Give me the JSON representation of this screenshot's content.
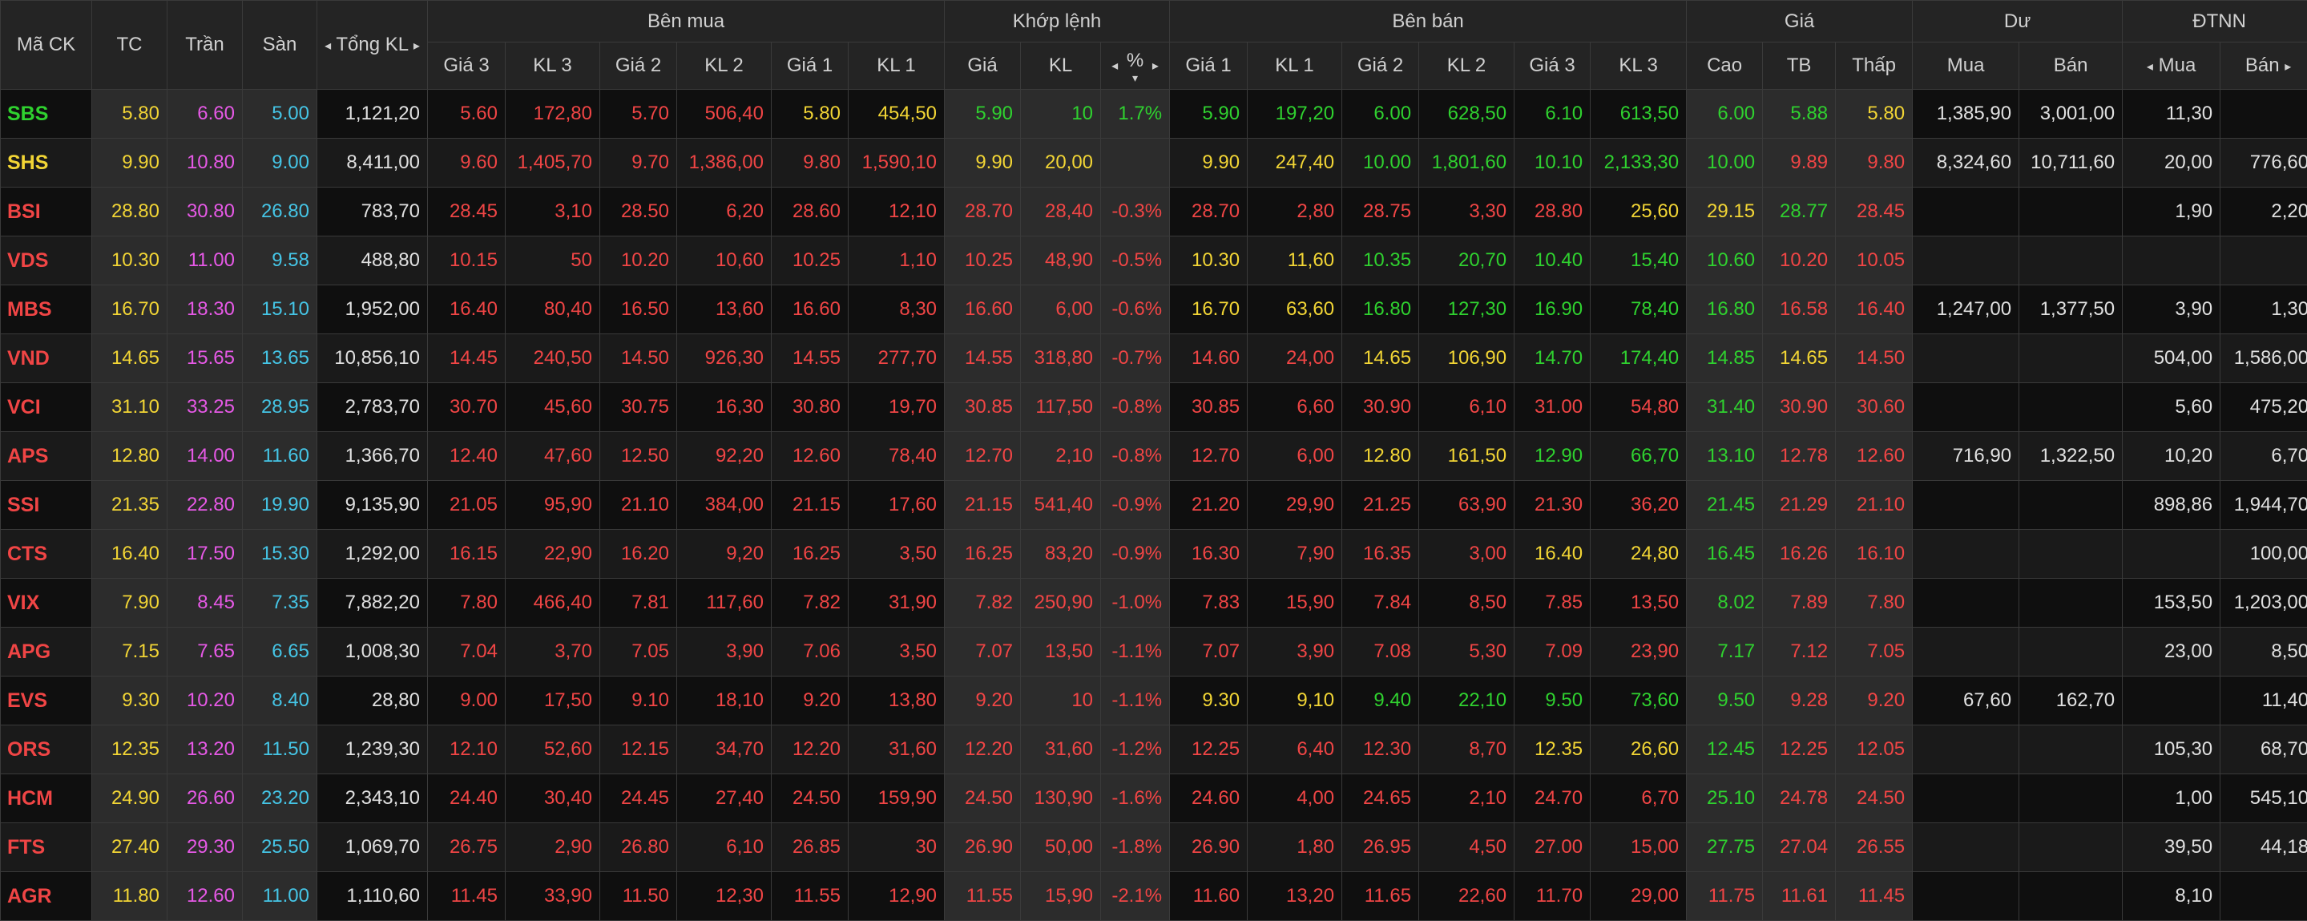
{
  "colors": {
    "up": "#2fd12f",
    "ref": "#f2d535",
    "down": "#f04545",
    "ceil": "#e659e6",
    "floor": "#45c5e6",
    "neutral": "#e0e0e0"
  },
  "headers": {
    "symbol": "Mã CK",
    "ref": "TC",
    "ceil": "Trần",
    "floor": "Sàn",
    "total_vol": "Tổng KL",
    "buy_side": "Bên mua",
    "match": "Khớp lệnh",
    "sell_side": "Bên bán",
    "price": "Giá",
    "remain": "Dư",
    "foreign": "ĐTNN",
    "buy": [
      "Giá 3",
      "KL 3",
      "Giá 2",
      "KL 2",
      "Giá 1",
      "KL 1"
    ],
    "match_cols": [
      "Giá",
      "KL",
      "%"
    ],
    "sell": [
      "Giá 1",
      "KL 1",
      "Giá 2",
      "KL 2",
      "Giá 3",
      "KL 3"
    ],
    "price_cols": [
      "Cao",
      "TB",
      "Thấp"
    ],
    "remain_cols": [
      "Mua",
      "Bán"
    ],
    "foreign_cols": [
      "Mua",
      "Bán"
    ]
  },
  "icons": {
    "left": "◂",
    "right": "▸",
    "sort_down": "▾"
  },
  "rows": [
    {
      "symbol": "SBS",
      "cells": [
        "5.80",
        "6.60",
        "5.00",
        "1,121,20",
        "5.60",
        "172,80",
        "5.70",
        "506,40",
        "5.80",
        "454,50",
        "5.90",
        "10",
        "1.7%",
        "5.90",
        "197,20",
        "6.00",
        "628,50",
        "6.10",
        "613,50",
        "6.00",
        "5.88",
        "5.80",
        "1,385,90",
        "3,001,00",
        "11,30",
        ""
      ],
      "colors": [
        "up",
        "ref",
        "ceil",
        "floor",
        "neutral",
        "down",
        "down",
        "down",
        "down",
        "ref",
        "ref",
        "up",
        "up",
        "up",
        "up",
        "up",
        "up",
        "up",
        "up",
        "up",
        "up",
        "up",
        "ref",
        "neutral",
        "neutral",
        "neutral",
        "neutral"
      ]
    },
    {
      "symbol": "SHS",
      "cells": [
        "9.90",
        "10.80",
        "9.00",
        "8,411,00",
        "9.60",
        "1,405,70",
        "9.70",
        "1,386,00",
        "9.80",
        "1,590,10",
        "9.90",
        "20,00",
        "",
        "9.90",
        "247,40",
        "10.00",
        "1,801,60",
        "10.10",
        "2,133,30",
        "10.00",
        "9.89",
        "9.80",
        "8,324,60",
        "10,711,60",
        "20,00",
        "776,60"
      ],
      "colors": [
        "ref",
        "ref",
        "ceil",
        "floor",
        "neutral",
        "down",
        "down",
        "down",
        "down",
        "down",
        "down",
        "ref",
        "ref",
        "ref",
        "ref",
        "ref",
        "up",
        "up",
        "up",
        "up",
        "up",
        "down",
        "down",
        "neutral",
        "neutral",
        "neutral",
        "neutral"
      ]
    },
    {
      "symbol": "BSI",
      "cells": [
        "28.80",
        "30.80",
        "26.80",
        "783,70",
        "28.45",
        "3,10",
        "28.50",
        "6,20",
        "28.60",
        "12,10",
        "28.70",
        "28,40",
        "-0.3%",
        "28.70",
        "2,80",
        "28.75",
        "3,30",
        "28.80",
        "25,60",
        "29.15",
        "28.77",
        "28.45",
        "",
        "",
        "1,90",
        "2,20"
      ],
      "colors": [
        "down",
        "ref",
        "ceil",
        "floor",
        "neutral",
        "down",
        "down",
        "down",
        "down",
        "down",
        "down",
        "down",
        "down",
        "down",
        "down",
        "down",
        "down",
        "down",
        "down",
        "ref",
        "ref",
        "up",
        "down",
        "down",
        "neutral",
        "neutral",
        "neutral",
        "neutral"
      ]
    },
    {
      "symbol": "VDS",
      "cells": [
        "10.30",
        "11.00",
        "9.58",
        "488,80",
        "10.15",
        "50",
        "10.20",
        "10,60",
        "10.25",
        "1,10",
        "10.25",
        "48,90",
        "-0.5%",
        "10.30",
        "11,60",
        "10.35",
        "20,70",
        "10.40",
        "15,40",
        "10.60",
        "10.20",
        "10.05",
        "",
        "",
        "",
        ""
      ],
      "colors": [
        "down",
        "ref",
        "ceil",
        "floor",
        "neutral",
        "down",
        "down",
        "down",
        "down",
        "down",
        "down",
        "down",
        "down",
        "down",
        "ref",
        "ref",
        "up",
        "up",
        "up",
        "up",
        "up",
        "down",
        "down",
        "neutral",
        "neutral",
        "neutral",
        "neutral"
      ]
    },
    {
      "symbol": "MBS",
      "cells": [
        "16.70",
        "18.30",
        "15.10",
        "1,952,00",
        "16.40",
        "80,40",
        "16.50",
        "13,60",
        "16.60",
        "8,30",
        "16.60",
        "6,00",
        "-0.6%",
        "16.70",
        "63,60",
        "16.80",
        "127,30",
        "16.90",
        "78,40",
        "16.80",
        "16.58",
        "16.40",
        "1,247,00",
        "1,377,50",
        "3,90",
        "1,30"
      ],
      "colors": [
        "down",
        "ref",
        "ceil",
        "floor",
        "neutral",
        "down",
        "down",
        "down",
        "down",
        "down",
        "down",
        "down",
        "down",
        "down",
        "ref",
        "ref",
        "up",
        "up",
        "up",
        "up",
        "up",
        "down",
        "down",
        "neutral",
        "neutral",
        "neutral",
        "neutral"
      ]
    },
    {
      "symbol": "VND",
      "cells": [
        "14.65",
        "15.65",
        "13.65",
        "10,856,10",
        "14.45",
        "240,50",
        "14.50",
        "926,30",
        "14.55",
        "277,70",
        "14.55",
        "318,80",
        "-0.7%",
        "14.60",
        "24,00",
        "14.65",
        "106,90",
        "14.70",
        "174,40",
        "14.85",
        "14.65",
        "14.50",
        "",
        "",
        "504,00",
        "1,586,00"
      ],
      "colors": [
        "down",
        "ref",
        "ceil",
        "floor",
        "neutral",
        "down",
        "down",
        "down",
        "down",
        "down",
        "down",
        "down",
        "down",
        "down",
        "down",
        "down",
        "ref",
        "ref",
        "up",
        "up",
        "up",
        "ref",
        "down",
        "neutral",
        "neutral",
        "neutral",
        "neutral"
      ]
    },
    {
      "symbol": "VCI",
      "cells": [
        "31.10",
        "33.25",
        "28.95",
        "2,783,70",
        "30.70",
        "45,60",
        "30.75",
        "16,30",
        "30.80",
        "19,70",
        "30.85",
        "117,50",
        "-0.8%",
        "30.85",
        "6,60",
        "30.90",
        "6,10",
        "31.00",
        "54,80",
        "31.40",
        "30.90",
        "30.60",
        "",
        "",
        "5,60",
        "475,20"
      ],
      "colors": [
        "down",
        "ref",
        "ceil",
        "floor",
        "neutral",
        "down",
        "down",
        "down",
        "down",
        "down",
        "down",
        "down",
        "down",
        "down",
        "down",
        "down",
        "down",
        "down",
        "down",
        "down",
        "up",
        "down",
        "down",
        "neutral",
        "neutral",
        "neutral",
        "neutral"
      ]
    },
    {
      "symbol": "APS",
      "cells": [
        "12.80",
        "14.00",
        "11.60",
        "1,366,70",
        "12.40",
        "47,60",
        "12.50",
        "92,20",
        "12.60",
        "78,40",
        "12.70",
        "2,10",
        "-0.8%",
        "12.70",
        "6,00",
        "12.80",
        "161,50",
        "12.90",
        "66,70",
        "13.10",
        "12.78",
        "12.60",
        "716,90",
        "1,322,50",
        "10,20",
        "6,70"
      ],
      "colors": [
        "down",
        "ref",
        "ceil",
        "floor",
        "neutral",
        "down",
        "down",
        "down",
        "down",
        "down",
        "down",
        "down",
        "down",
        "down",
        "down",
        "down",
        "ref",
        "ref",
        "up",
        "up",
        "up",
        "down",
        "down",
        "neutral",
        "neutral",
        "neutral",
        "neutral"
      ]
    },
    {
      "symbol": "SSI",
      "cells": [
        "21.35",
        "22.80",
        "19.90",
        "9,135,90",
        "21.05",
        "95,90",
        "21.10",
        "384,00",
        "21.15",
        "17,60",
        "21.15",
        "541,40",
        "-0.9%",
        "21.20",
        "29,90",
        "21.25",
        "63,90",
        "21.30",
        "36,20",
        "21.45",
        "21.29",
        "21.10",
        "",
        "",
        "898,86",
        "1,944,70"
      ],
      "colors": [
        "down",
        "ref",
        "ceil",
        "floor",
        "neutral",
        "down",
        "down",
        "down",
        "down",
        "down",
        "down",
        "down",
        "down",
        "down",
        "down",
        "down",
        "down",
        "down",
        "down",
        "down",
        "up",
        "down",
        "down",
        "neutral",
        "neutral",
        "neutral",
        "neutral"
      ]
    },
    {
      "symbol": "CTS",
      "cells": [
        "16.40",
        "17.50",
        "15.30",
        "1,292,00",
        "16.15",
        "22,90",
        "16.20",
        "9,20",
        "16.25",
        "3,50",
        "16.25",
        "83,20",
        "-0.9%",
        "16.30",
        "7,90",
        "16.35",
        "3,00",
        "16.40",
        "24,80",
        "16.45",
        "16.26",
        "16.10",
        "",
        "",
        "",
        "100,00"
      ],
      "colors": [
        "down",
        "ref",
        "ceil",
        "floor",
        "neutral",
        "down",
        "down",
        "down",
        "down",
        "down",
        "down",
        "down",
        "down",
        "down",
        "down",
        "down",
        "down",
        "down",
        "ref",
        "ref",
        "up",
        "down",
        "down",
        "neutral",
        "neutral",
        "neutral",
        "neutral"
      ]
    },
    {
      "symbol": "VIX",
      "cells": [
        "7.90",
        "8.45",
        "7.35",
        "7,882,20",
        "7.80",
        "466,40",
        "7.81",
        "117,60",
        "7.82",
        "31,90",
        "7.82",
        "250,90",
        "-1.0%",
        "7.83",
        "15,90",
        "7.84",
        "8,50",
        "7.85",
        "13,50",
        "8.02",
        "7.89",
        "7.80",
        "",
        "",
        "153,50",
        "1,203,00"
      ],
      "colors": [
        "down",
        "ref",
        "ceil",
        "floor",
        "neutral",
        "down",
        "down",
        "down",
        "down",
        "down",
        "down",
        "down",
        "down",
        "down",
        "down",
        "down",
        "down",
        "down",
        "down",
        "down",
        "up",
        "down",
        "down",
        "neutral",
        "neutral",
        "neutral",
        "neutral"
      ]
    },
    {
      "symbol": "APG",
      "cells": [
        "7.15",
        "7.65",
        "6.65",
        "1,008,30",
        "7.04",
        "3,70",
        "7.05",
        "3,90",
        "7.06",
        "3,50",
        "7.07",
        "13,50",
        "-1.1%",
        "7.07",
        "3,90",
        "7.08",
        "5,30",
        "7.09",
        "23,90",
        "7.17",
        "7.12",
        "7.05",
        "",
        "",
        "23,00",
        "8,50"
      ],
      "colors": [
        "down",
        "ref",
        "ceil",
        "floor",
        "neutral",
        "down",
        "down",
        "down",
        "down",
        "down",
        "down",
        "down",
        "down",
        "down",
        "down",
        "down",
        "down",
        "down",
        "down",
        "down",
        "up",
        "down",
        "down",
        "neutral",
        "neutral",
        "neutral",
        "neutral"
      ]
    },
    {
      "symbol": "EVS",
      "cells": [
        "9.30",
        "10.20",
        "8.40",
        "28,80",
        "9.00",
        "17,50",
        "9.10",
        "18,10",
        "9.20",
        "13,80",
        "9.20",
        "10",
        "-1.1%",
        "9.30",
        "9,10",
        "9.40",
        "22,10",
        "9.50",
        "73,60",
        "9.50",
        "9.28",
        "9.20",
        "67,60",
        "162,70",
        "",
        "11,40"
      ],
      "colors": [
        "down",
        "ref",
        "ceil",
        "floor",
        "neutral",
        "down",
        "down",
        "down",
        "down",
        "down",
        "down",
        "down",
        "down",
        "down",
        "ref",
        "ref",
        "up",
        "up",
        "up",
        "up",
        "up",
        "down",
        "down",
        "neutral",
        "neutral",
        "neutral",
        "neutral"
      ]
    },
    {
      "symbol": "ORS",
      "cells": [
        "12.35",
        "13.20",
        "11.50",
        "1,239,30",
        "12.10",
        "52,60",
        "12.15",
        "34,70",
        "12.20",
        "31,60",
        "12.20",
        "31,60",
        "-1.2%",
        "12.25",
        "6,40",
        "12.30",
        "8,70",
        "12.35",
        "26,60",
        "12.45",
        "12.25",
        "12.05",
        "",
        "",
        "105,30",
        "68,70"
      ],
      "colors": [
        "down",
        "ref",
        "ceil",
        "floor",
        "neutral",
        "down",
        "down",
        "down",
        "down",
        "down",
        "down",
        "down",
        "down",
        "down",
        "down",
        "down",
        "down",
        "down",
        "ref",
        "ref",
        "up",
        "down",
        "down",
        "neutral",
        "neutral",
        "neutral",
        "neutral"
      ]
    },
    {
      "symbol": "HCM",
      "cells": [
        "24.90",
        "26.60",
        "23.20",
        "2,343,10",
        "24.40",
        "30,40",
        "24.45",
        "27,40",
        "24.50",
        "159,90",
        "24.50",
        "130,90",
        "-1.6%",
        "24.60",
        "4,00",
        "24.65",
        "2,10",
        "24.70",
        "6,70",
        "25.10",
        "24.78",
        "24.50",
        "",
        "",
        "1,00",
        "545,10"
      ],
      "colors": [
        "down",
        "ref",
        "ceil",
        "floor",
        "neutral",
        "down",
        "down",
        "down",
        "down",
        "down",
        "down",
        "down",
        "down",
        "down",
        "down",
        "down",
        "down",
        "down",
        "down",
        "down",
        "up",
        "down",
        "down",
        "neutral",
        "neutral",
        "neutral",
        "neutral"
      ]
    },
    {
      "symbol": "FTS",
      "cells": [
        "27.40",
        "29.30",
        "25.50",
        "1,069,70",
        "26.75",
        "2,90",
        "26.80",
        "6,10",
        "26.85",
        "30",
        "26.90",
        "50,00",
        "-1.8%",
        "26.90",
        "1,80",
        "26.95",
        "4,50",
        "27.00",
        "15,00",
        "27.75",
        "27.04",
        "26.55",
        "",
        "",
        "39,50",
        "44,18"
      ],
      "colors": [
        "down",
        "ref",
        "ceil",
        "floor",
        "neutral",
        "down",
        "down",
        "down",
        "down",
        "down",
        "down",
        "down",
        "down",
        "down",
        "down",
        "down",
        "down",
        "down",
        "down",
        "down",
        "up",
        "down",
        "down",
        "neutral",
        "neutral",
        "neutral",
        "neutral"
      ]
    },
    {
      "symbol": "AGR",
      "cells": [
        "11.80",
        "12.60",
        "11.00",
        "1,110,60",
        "11.45",
        "33,90",
        "11.50",
        "12,30",
        "11.55",
        "12,90",
        "11.55",
        "15,90",
        "-2.1%",
        "11.60",
        "13,20",
        "11.65",
        "22,60",
        "11.70",
        "29,00",
        "11.75",
        "11.61",
        "11.45",
        "",
        "",
        "8,10",
        ""
      ],
      "colors": [
        "down",
        "ref",
        "ceil",
        "floor",
        "neutral",
        "down",
        "down",
        "down",
        "down",
        "down",
        "down",
        "down",
        "down",
        "down",
        "down",
        "down",
        "down",
        "down",
        "down",
        "down",
        "down",
        "down",
        "down",
        "neutral",
        "neutral",
        "neutral",
        "neutral"
      ]
    }
  ]
}
